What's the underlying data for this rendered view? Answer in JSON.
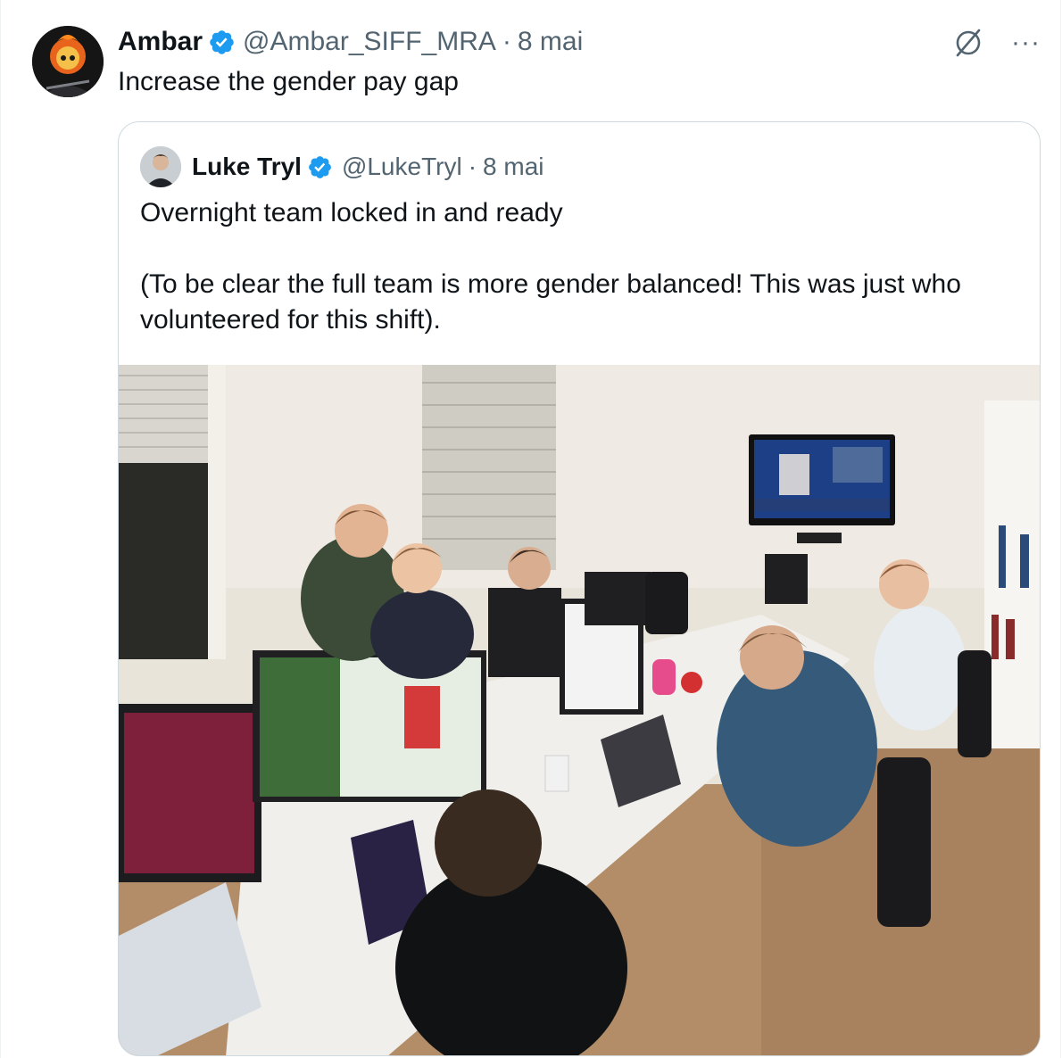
{
  "tweet": {
    "author_name": "Ambar",
    "handle": "@Ambar_SIFF_MRA",
    "separator": "·",
    "date": "8 mai",
    "text": "Increase the gender pay gap",
    "icons": [
      "grok-icon",
      "more-icon"
    ],
    "more_label": "···"
  },
  "quoted_tweet": {
    "author_name": "Luke Tryl",
    "handle": "@LukeTryl",
    "separator": "·",
    "date": "8 mai",
    "text": "Overnight team locked in and ready\n\n(To be clear the full team is more gender balanced! This was just who volunteered for this shift).",
    "photo_description_icon": "office-photo"
  },
  "colors": {
    "verified": "#1d9bf0",
    "secondary_text": "#536471",
    "border": "#cfd9de"
  }
}
